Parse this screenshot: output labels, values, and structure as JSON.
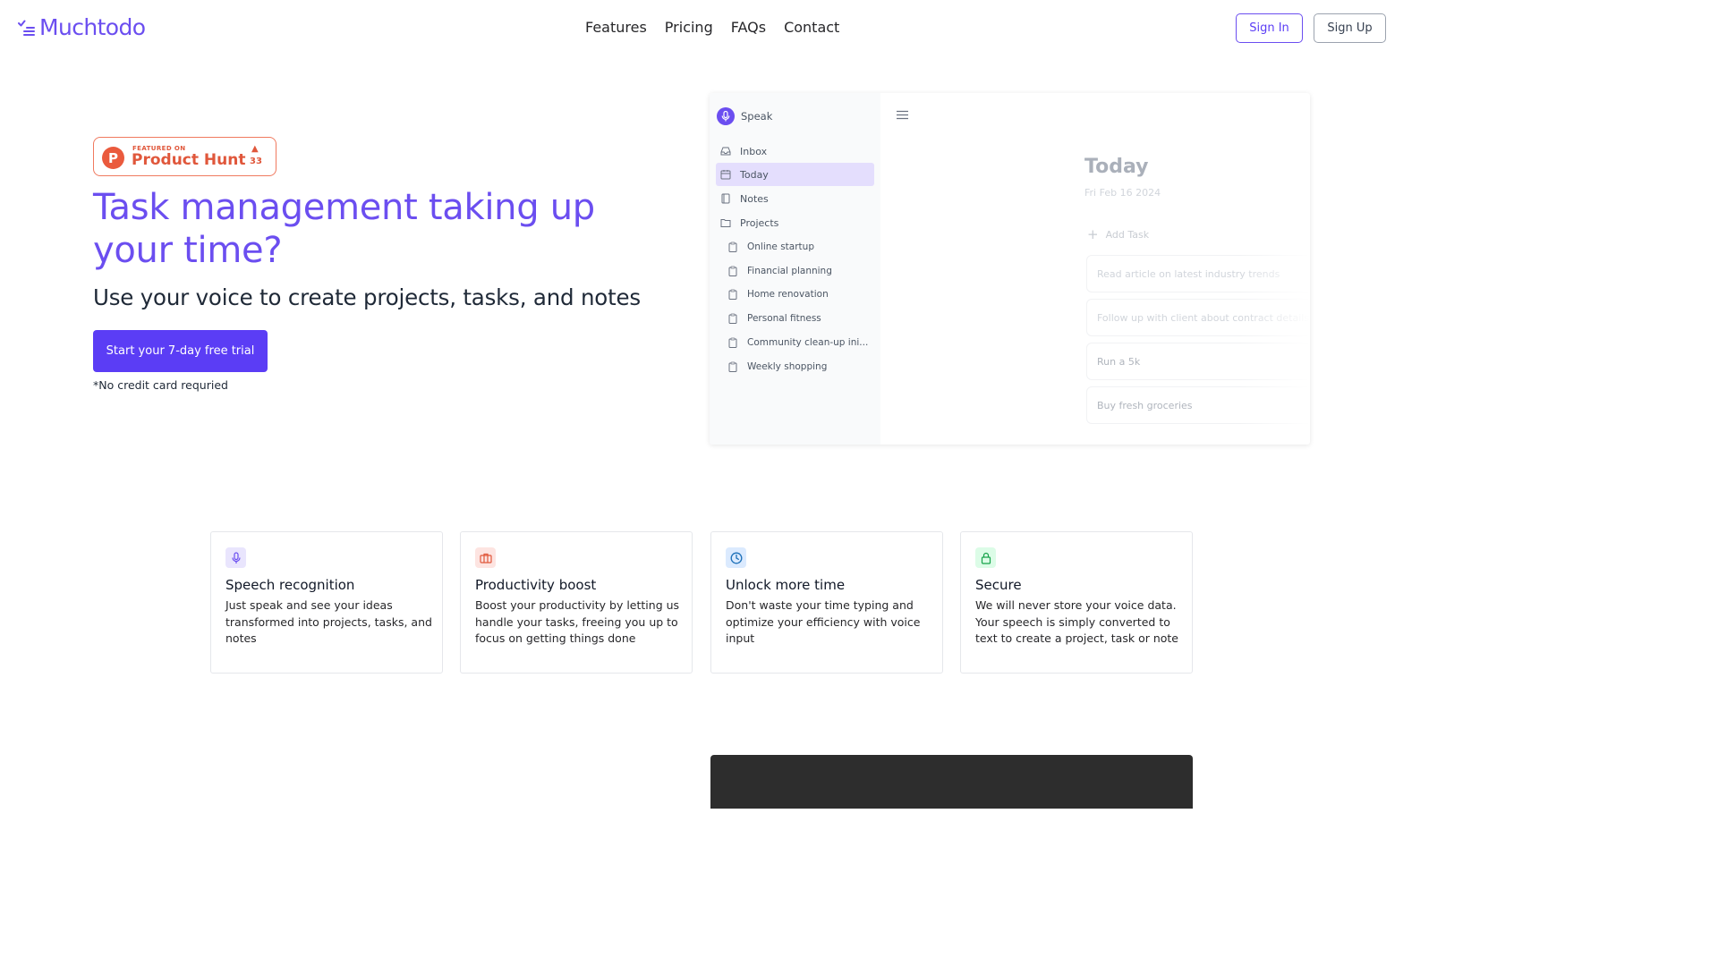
{
  "brand": {
    "name": "Muchtodo",
    "accent": "#6b4ef0",
    "primary": "#5b3df5"
  },
  "nav": {
    "links": [
      "Features",
      "Pricing",
      "FAQs",
      "Contact"
    ],
    "sign_in": "Sign In",
    "sign_up": "Sign Up"
  },
  "product_hunt": {
    "featured_on": "FEATURED ON",
    "name": "Product Hunt",
    "count": "33",
    "logo_letter": "P",
    "color": "#e0573b"
  },
  "hero": {
    "title": "Task management taking up your time?",
    "subtitle": "Use your voice to create projects, tasks, and notes",
    "cta": "Start your 7-day free trial",
    "note": "*No credit card requried"
  },
  "app_preview": {
    "speak_label": "Speak",
    "sidebar": [
      {
        "label": "Inbox",
        "icon": "inbox-icon"
      },
      {
        "label": "Today",
        "icon": "calendar-icon",
        "active": true
      },
      {
        "label": "Notes",
        "icon": "notebook-icon"
      },
      {
        "label": "Projects",
        "icon": "folder-icon"
      }
    ],
    "projects": [
      "Online startup",
      "Financial planning",
      "Home renovation",
      "Personal fitness",
      "Community clean-up ini...",
      "Weekly shopping"
    ],
    "main": {
      "title": "Today",
      "date": "Fri Feb 16 2024",
      "add_task": "Add Task",
      "tasks": [
        "Read article on latest industry trends",
        "Follow up with client about contract details",
        "Run a 5k",
        "Buy fresh groceries"
      ]
    }
  },
  "features": [
    {
      "title": "Speech recognition",
      "desc": "Just speak and see your ideas transformed into projects, tasks, and notes",
      "icon": "microphone-icon",
      "icon_bg": "#e9e5fd",
      "icon_color": "#6b4ef0"
    },
    {
      "title": "Productivity boost",
      "desc": "Boost your productivity by letting us handle your tasks, freeing you up to focus on getting things done",
      "icon": "briefcase-icon",
      "icon_bg": "#fde4e1",
      "icon_color": "#e0573b"
    },
    {
      "title": "Unlock more time",
      "desc": "Don't waste your time typing and optimize your efficiency with voice input",
      "icon": "clock-icon",
      "icon_bg": "#dbeafe",
      "icon_color": "#1d70b8"
    },
    {
      "title": "Secure",
      "desc": "We will never store your voice data. Your speech is simply converted to text to create a project, task or note",
      "icon": "lock-icon",
      "icon_bg": "#dcfce7",
      "icon_color": "#16a34a"
    }
  ]
}
